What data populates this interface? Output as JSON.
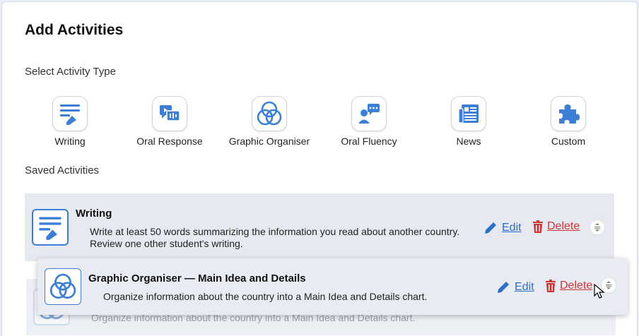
{
  "header": {
    "title": "Add Activities"
  },
  "select_type": {
    "label": "Select Activity Type",
    "types": [
      {
        "label": "Writing",
        "icon": "writing-icon"
      },
      {
        "label": "Oral Response",
        "icon": "oral-response-icon"
      },
      {
        "label": "Graphic Organiser",
        "icon": "graphic-organiser-icon"
      },
      {
        "label": "Oral Fluency",
        "icon": "oral-fluency-icon"
      },
      {
        "label": "News",
        "icon": "news-icon"
      },
      {
        "label": "Custom",
        "icon": "puzzle-icon"
      }
    ]
  },
  "saved": {
    "label": "Saved Activities",
    "items": [
      {
        "title": "Writing",
        "description_line1": "Write at least 50 words summarizing the information you read about another country.",
        "description_line2": "Review one other student's writing.",
        "edit_label": "Edit",
        "delete_label": "Delete"
      },
      {
        "title": "Graphic Organiser — Main Idea and Details",
        "description_line1": "Organize information about the country into a Main Idea and Details chart.",
        "edit_label": "Edit",
        "delete_label": "Delete"
      }
    ]
  },
  "colors": {
    "accent": "#3b7fd9",
    "edit": "#2a6fc9",
    "delete": "#d03535"
  }
}
